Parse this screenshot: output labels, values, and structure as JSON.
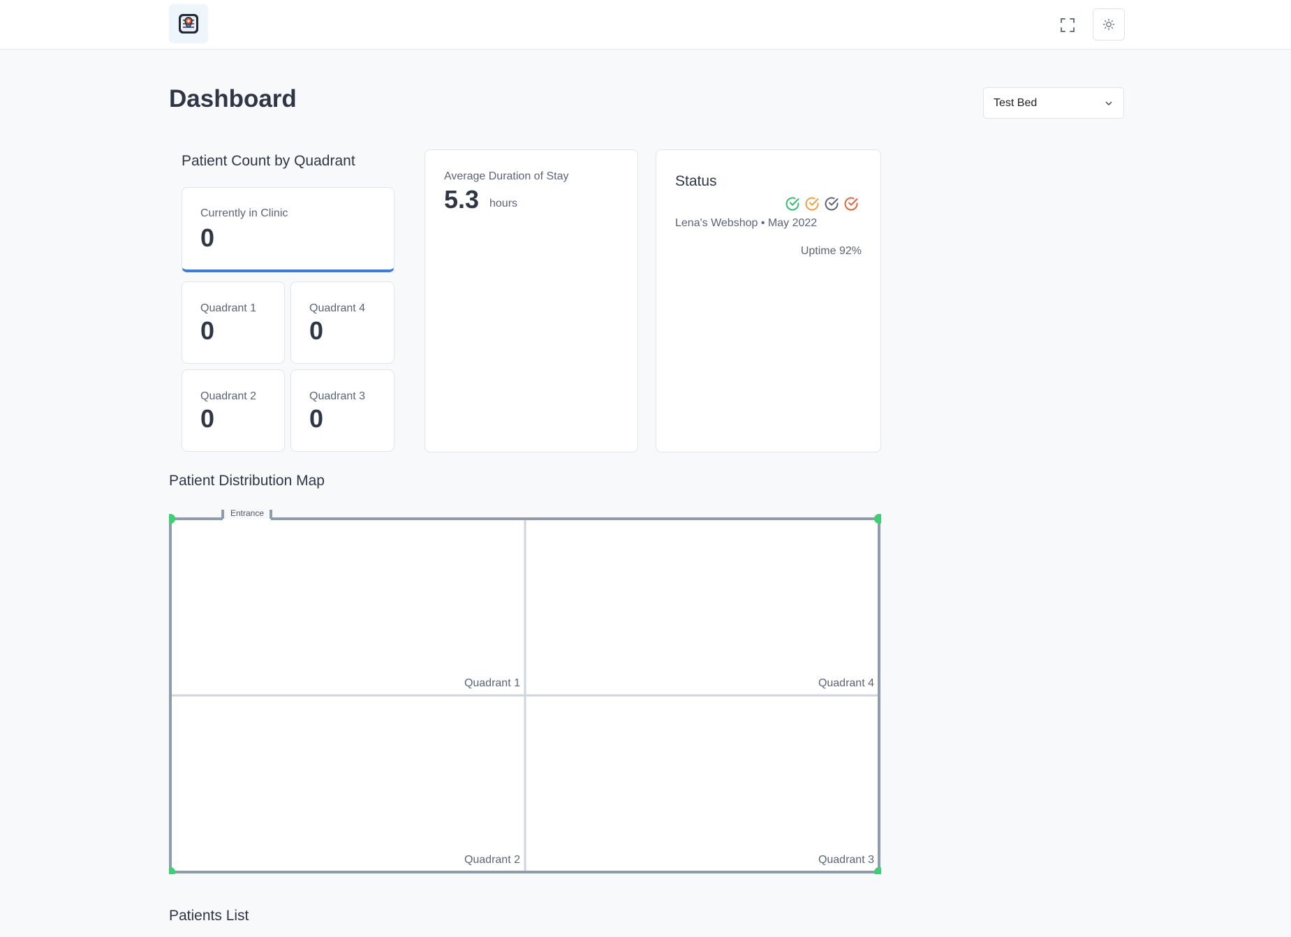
{
  "header": {
    "logo_icon": "clinic-map-logo-icon",
    "expand_icon": "fullscreen-icon",
    "theme_icon": "sun-icon"
  },
  "page": {
    "title": "Dashboard",
    "selector_value": "Test Bed"
  },
  "patient_count": {
    "title": "Patient Count by Quadrant",
    "currently_label": "Currently in Clinic",
    "currently_value": "0",
    "quadrants": [
      {
        "label": "Quadrant 1",
        "value": "0"
      },
      {
        "label": "Quadrant 4",
        "value": "0"
      },
      {
        "label": "Quadrant 2",
        "value": "0"
      },
      {
        "label": "Quadrant 3",
        "value": "0"
      }
    ]
  },
  "duration": {
    "label": "Average Duration of Stay",
    "value": "5.3",
    "unit": "hours"
  },
  "status": {
    "title": "Status",
    "icons": [
      "check-circle-green-icon",
      "check-circle-orange-icon",
      "check-circle-gray-icon",
      "check-circle-red-icon"
    ],
    "icon_colors": [
      "#2fbf71",
      "#f0a040",
      "#5b6473",
      "#e0653b"
    ],
    "source": "Lena's Webshop • May 2022",
    "uptime": "Uptime 92%"
  },
  "map": {
    "title": "Patient Distribution Map",
    "entrance_label": "Entrance",
    "quadrant_labels": [
      "Quadrant 1",
      "Quadrant 4",
      "Quadrant 2",
      "Quadrant 3"
    ],
    "corner_color": "#3ecf75"
  },
  "patients": {
    "title": "Patients List"
  }
}
